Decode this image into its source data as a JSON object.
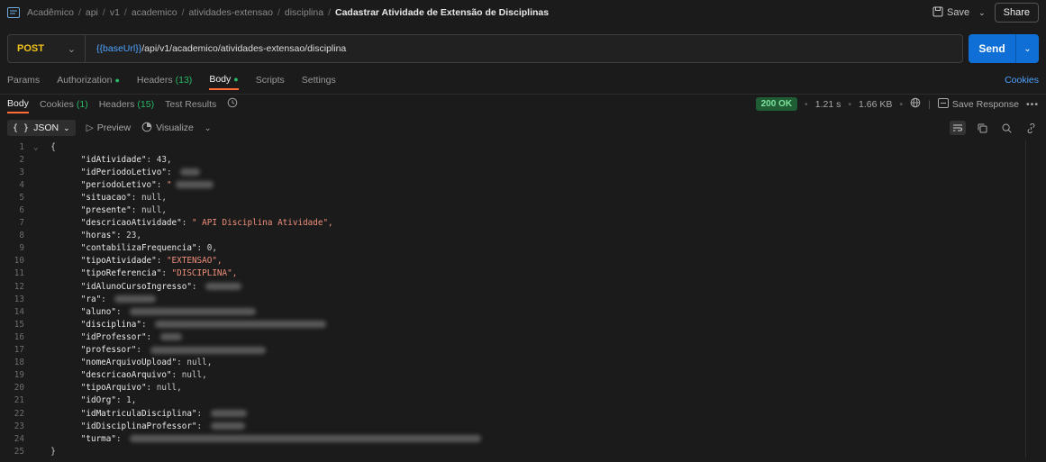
{
  "header": {
    "breadcrumbs": [
      "Acadêmico",
      "api",
      "v1",
      "academico",
      "atividades-extensao",
      "disciplina"
    ],
    "current": "Cadastrar Atividade de Extensão de Disciplinas",
    "save_label": "Save",
    "share_label": "Share"
  },
  "request": {
    "method": "POST",
    "url_var": "{{baseUrl}}",
    "url_path": "/api/v1/academico/atividades-extensao/disciplina",
    "send_label": "Send"
  },
  "request_tabs": {
    "params": "Params",
    "authorization": "Authorization",
    "headers": "Headers",
    "headers_count": "(13)",
    "body": "Body",
    "scripts": "Scripts",
    "settings": "Settings",
    "cookies": "Cookies"
  },
  "response_tabs": {
    "body": "Body",
    "cookies": "Cookies",
    "cookies_count": "(1)",
    "headers": "Headers",
    "headers_count": "(15)",
    "test_results": "Test Results",
    "status": "200 OK",
    "time": "1.21 s",
    "size": "1.66 KB",
    "save_response": "Save Response"
  },
  "toolbar": {
    "format": "JSON",
    "format_braces": "{ }",
    "preview": "Preview",
    "visualize": "Visualize"
  },
  "code_lines": [
    {
      "no": "1",
      "fold": "⌄",
      "key": "",
      "punct": "{",
      "value": "",
      "vtype": "",
      "blur": 0
    },
    {
      "no": "2",
      "fold": "",
      "key": "\"idAtividade\"",
      "punct": ": ",
      "value": "43,",
      "vtype": "n",
      "blur": 0
    },
    {
      "no": "3",
      "fold": "",
      "key": "\"idPeriodoLetivo\"",
      "punct": ": ",
      "value": "",
      "vtype": "",
      "blur": 22
    },
    {
      "no": "4",
      "fold": "",
      "key": "\"periodoLetivo\"",
      "punct": ": ",
      "value": "\"",
      "vtype": "s",
      "blur": 42
    },
    {
      "no": "5",
      "fold": "",
      "key": "\"situacao\"",
      "punct": ": ",
      "value": "null,",
      "vtype": "nul",
      "blur": 0
    },
    {
      "no": "6",
      "fold": "",
      "key": "\"presente\"",
      "punct": ": ",
      "value": "null,",
      "vtype": "nul",
      "blur": 0
    },
    {
      "no": "7",
      "fold": "",
      "key": "\"descricaoAtividade\"",
      "punct": ": ",
      "value": "\" API Disciplina Atividade\",",
      "vtype": "s",
      "blur": 0
    },
    {
      "no": "8",
      "fold": "",
      "key": "\"horas\"",
      "punct": ": ",
      "value": "23,",
      "vtype": "n",
      "blur": 0
    },
    {
      "no": "9",
      "fold": "",
      "key": "\"contabilizaFrequencia\"",
      "punct": ": ",
      "value": "0,",
      "vtype": "n",
      "blur": 0
    },
    {
      "no": "10",
      "fold": "",
      "key": "\"tipoAtividade\"",
      "punct": ": ",
      "value": "\"EXTENSAO\",",
      "vtype": "s",
      "blur": 0
    },
    {
      "no": "11",
      "fold": "",
      "key": "\"tipoReferencia\"",
      "punct": ": ",
      "value": "\"DISCIPLINA\",",
      "vtype": "s",
      "blur": 0
    },
    {
      "no": "12",
      "fold": "",
      "key": "\"idAlunoCursoIngresso\"",
      "punct": ": ",
      "value": "",
      "vtype": "",
      "blur": 40
    },
    {
      "no": "13",
      "fold": "",
      "key": "\"ra\"",
      "punct": ": ",
      "value": "",
      "vtype": "",
      "blur": 46
    },
    {
      "no": "14",
      "fold": "",
      "key": "\"aluno\"",
      "punct": ": ",
      "value": "",
      "vtype": "",
      "blur": 140
    },
    {
      "no": "15",
      "fold": "",
      "key": "\"disciplina\"",
      "punct": ": ",
      "value": "",
      "vtype": "",
      "blur": 190
    },
    {
      "no": "16",
      "fold": "",
      "key": "\"idProfessor\"",
      "punct": ": ",
      "value": "",
      "vtype": "",
      "blur": 24
    },
    {
      "no": "17",
      "fold": "",
      "key": "\"professor\"",
      "punct": ": ",
      "value": "",
      "vtype": "",
      "blur": 128
    },
    {
      "no": "18",
      "fold": "",
      "key": "\"nomeArquivoUpload\"",
      "punct": ": ",
      "value": "null,",
      "vtype": "nul",
      "blur": 0
    },
    {
      "no": "19",
      "fold": "",
      "key": "\"descricaoArquivo\"",
      "punct": ": ",
      "value": "null,",
      "vtype": "nul",
      "blur": 0
    },
    {
      "no": "20",
      "fold": "",
      "key": "\"tipoArquivo\"",
      "punct": ": ",
      "value": "null,",
      "vtype": "nul",
      "blur": 0
    },
    {
      "no": "21",
      "fold": "",
      "key": "\"idOrg\"",
      "punct": ": ",
      "value": "1,",
      "vtype": "n",
      "blur": 0
    },
    {
      "no": "22",
      "fold": "",
      "key": "\"idMatriculaDisciplina\"",
      "punct": ": ",
      "value": "",
      "vtype": "",
      "blur": 40
    },
    {
      "no": "23",
      "fold": "",
      "key": "\"idDisciplinaProfessor\"",
      "punct": ": ",
      "value": "",
      "vtype": "",
      "blur": 38
    },
    {
      "no": "24",
      "fold": "",
      "key": "\"turma\"",
      "punct": ": ",
      "value": "",
      "vtype": "",
      "blur": 390
    },
    {
      "no": "25",
      "fold": "",
      "key": "",
      "punct": "}",
      "value": "",
      "vtype": "",
      "blur": 0
    }
  ]
}
